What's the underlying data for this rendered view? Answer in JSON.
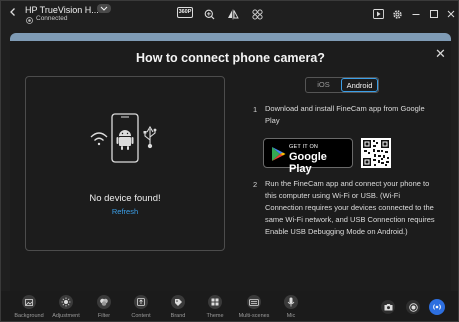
{
  "titlebar": {
    "device_name": "HP TrueVision H...",
    "status": "Connected",
    "resolution_badge": "360P",
    "icons": [
      "resolution-icon",
      "zoom-icon",
      "mirror-icon",
      "grid-icon",
      "play-icon",
      "settings-icon",
      "minimize-icon",
      "maximize-icon",
      "close-icon"
    ]
  },
  "modal": {
    "title": "How to connect phone camera?",
    "close_glyph": "✕",
    "device_panel": {
      "message": "No device found!",
      "refresh_link": "Refresh"
    },
    "platform_tabs": [
      {
        "label": "iOS",
        "selected": false
      },
      {
        "label": "Android",
        "selected": true
      }
    ],
    "steps": [
      {
        "number": "1",
        "text": "Download and install FineCam app from Google Play"
      },
      {
        "number": "2",
        "text": "Run the FineCam app and connect your phone to this computer using Wi-Fi or USB. (Wi-Fi Connection requires your devices connected to the same Wi-Fi network, and USB Connection requires Enable USB Debugging Mode on Android.)"
      }
    ],
    "google_play": {
      "small_text": "GET IT ON",
      "big_text": "Google Play"
    }
  },
  "bottombar": {
    "items": [
      {
        "label": "Background",
        "icon": "image-icon"
      },
      {
        "label": "Adjustment",
        "icon": "brightness-icon"
      },
      {
        "label": "Filter",
        "icon": "filter-icon"
      },
      {
        "label": "Content",
        "icon": "upload-icon"
      },
      {
        "label": "Brand",
        "icon": "tag-icon"
      },
      {
        "label": "Theme",
        "icon": "theme-icon"
      },
      {
        "label": "Multi-scenes",
        "icon": "keyboard-icon"
      },
      {
        "label": "Mic",
        "icon": "mic-icon"
      }
    ],
    "right_icons": [
      "camera-icon",
      "record-icon",
      "live-icon"
    ]
  },
  "colors": {
    "accent": "#3b9fe8",
    "window_bg": "#1f1f1f",
    "live_button": "#2d6fe0",
    "status_green": "#35c759"
  }
}
